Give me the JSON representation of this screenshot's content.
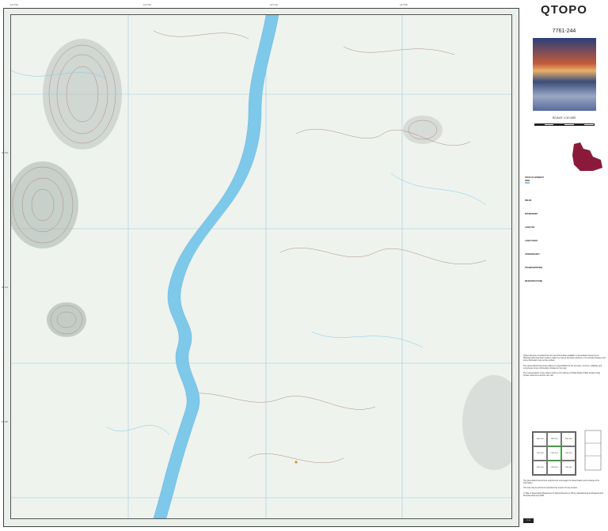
{
  "map": {
    "title": "QTOPO",
    "sheet_id": "7761-244",
    "scale": "SCALE 1:10,000",
    "top_ticks": [
      "147°00'",
      "147°02'",
      "147°04'",
      "147°06'"
    ],
    "left_ticks": [
      "20°03'",
      "20°04'",
      "20°05'",
      "20°06'",
      "20°07'"
    ],
    "colors": {
      "background": "#eef3ee",
      "river": "#7ec8ea",
      "contour": "#b08a7a",
      "grid": "#9fc9df",
      "hill_shade": "#7d8a84"
    }
  },
  "legend": {
    "headings": [
      "STATE OF INTEREST",
      "RELIEF",
      "BOUNDARIES",
      "LAND USE",
      "LAND COVER",
      "HYDROGRAPHY",
      "TRANSPORTATION",
      "INFRASTRUCTURE"
    ]
  },
  "text": {
    "disclaimer_1": "QTopo has been compiled from the best information available to Queensland Government. Although effort has been made to make the map as accurate reference, it is not field checked, and some information may not be verified.",
    "disclaimer_2": "The Queensland Government takes no responsibility for the accuracy, currency, reliability, and correctness of any information included on the map.",
    "disclaimer_3": "The representation of any road or track is not evidence of Public Right of Way. People using private roads do so at their own risk.",
    "publish_note": "This map may be printed or reproduced by anyone for any purpose.",
    "copyright": "© State of Queensland (Department of Natural Resources, Mines, Manufacturing and Regional and Rural Development) 2023",
    "support": "The Queensland Government supports and encourages the dissemination and exchange of its information."
  },
  "tiles": [
    "7861-134",
    "7861-244",
    "7861-344",
    "7761-143",
    "7761-244",
    "7761-343",
    "7761-142",
    "7761-243",
    "7761-342"
  ],
  "cc_label": "CC BY"
}
